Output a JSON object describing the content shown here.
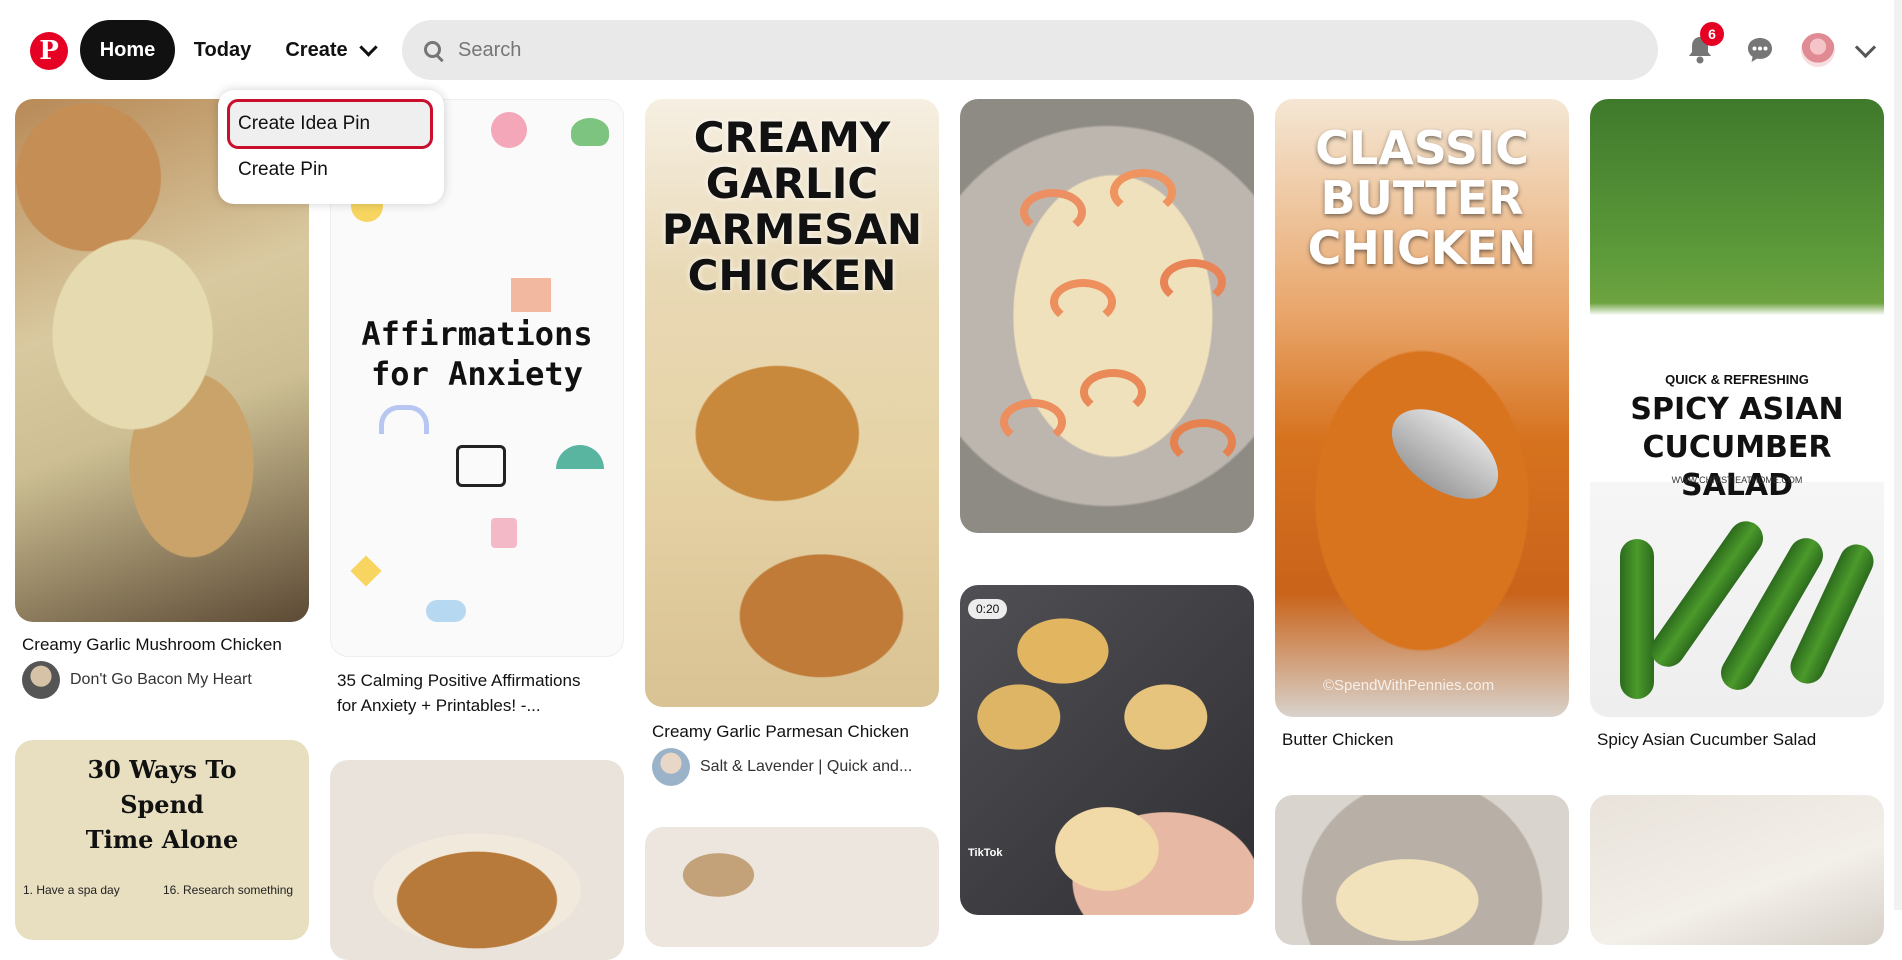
{
  "header": {
    "logo_letter": "P",
    "nav": {
      "home": "Home",
      "today": "Today",
      "create": "Create"
    },
    "search": {
      "placeholder": "Search"
    },
    "notifications_count": "6"
  },
  "create_menu": {
    "items": [
      "Create Idea Pin",
      "Create Pin"
    ]
  },
  "pins": [
    {
      "title": "Creamy Garlic Mushroom Chicken",
      "source": "Don't Go Bacon My Heart"
    },
    {
      "image_text": "30 Ways To Spend Time Alone",
      "list_items": [
        "1. Have a spa day",
        "16. Research something"
      ]
    },
    {
      "image_text": "Affirmations for Anxiety",
      "title": "35 Calming Positive Affirmations for Anxiety + Printables! -..."
    },
    {
      "image_text": "CREAMY GARLIC PARMESAN CHICKEN",
      "title": "Creamy Garlic Parmesan Chicken",
      "source": "Salt & Lavender | Quick and..."
    },
    {
      "video_duration": "0:20",
      "watermark": "TikTok"
    },
    {
      "image_text": "CLASSIC BUTTER CHICKEN",
      "title": "Butter Chicken",
      "watermark": "©SpendWithPennies.com"
    },
    {
      "image_kicker": "QUICK & REFRESHING",
      "image_text": "SPICY ASIAN CUCUMBER SALAD",
      "image_url_text": "WWW.CHRISTIEATHOME.COM",
      "title": "Spicy Asian Cucumber Salad"
    }
  ],
  "colors": {
    "brand": "#e60023",
    "nav_active_bg": "#111111",
    "search_bg": "#e9e9e9",
    "highlight_outline": "#c8102e"
  }
}
